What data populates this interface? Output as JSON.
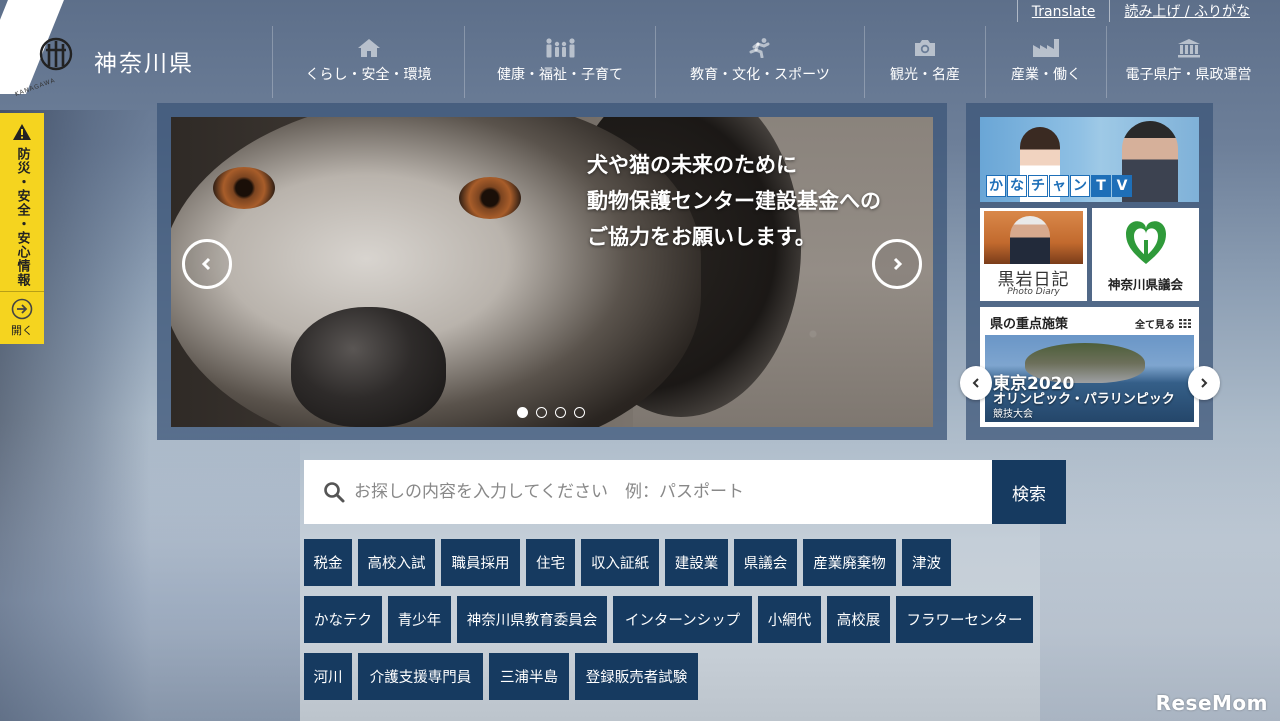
{
  "brand": {
    "name": "神奈川県",
    "sub": "KANAGAWA"
  },
  "utility": {
    "translate": "Translate",
    "read_aloud": "読み上げ / ふりがな"
  },
  "nav": {
    "items": [
      {
        "label": "くらし・安全・環境",
        "icon": "house-icon"
      },
      {
        "label": "健康・福祉・子育て",
        "icon": "family-icon"
      },
      {
        "label": "教育・文化・スポーツ",
        "icon": "runner-icon"
      },
      {
        "label": "観光・名産",
        "icon": "camera-icon"
      },
      {
        "label": "産業・働く",
        "icon": "factory-icon"
      },
      {
        "label": "電子県庁・県政運営",
        "icon": "government-building-icon"
      }
    ]
  },
  "disaster": {
    "label": "防災・安全・安心情報",
    "open": "開く"
  },
  "carousel": {
    "caption_lines": [
      "犬や猫の未来のために",
      "動物保護センター建設基金への",
      "ご協力をお願いします。"
    ],
    "slide_count": 4,
    "active_slide": 1
  },
  "side": {
    "tv_chars": [
      "か",
      "な",
      "チ",
      "ャ",
      "ン",
      "T",
      "V"
    ],
    "diary_title": "黒岩日記",
    "diary_sub": "Photo Diary",
    "council": "神奈川県議会",
    "policy_head": "県の重点施策",
    "policy_more": "全て見る",
    "policy_line1": "東京2020",
    "policy_line2": "オリンピック・パラリンピック",
    "policy_line3": "競技大会"
  },
  "search": {
    "placeholder": "お探しの内容を入力してください　例：パスポート",
    "button": "検索"
  },
  "tags": {
    "row1": [
      "税金",
      "高校入試",
      "職員採用",
      "住宅",
      "収入証紙",
      "建設業",
      "県議会",
      "産業廃棄物",
      "津波"
    ],
    "row2": [
      "かなテク",
      "青少年",
      "神奈川県教育委員会",
      "インターンシップ",
      "小網代",
      "高校展",
      "フラワーセンター"
    ],
    "row3": [
      "河川",
      "介護支援専門員",
      "三浦半島",
      "登録販売者試験"
    ]
  },
  "watermark": "ReseMom",
  "colors": {
    "navy": "#163a60",
    "disaster_yellow": "#f5d41f",
    "tv_blue": "#1e6fb8",
    "council_green": "#2f9a3a"
  }
}
